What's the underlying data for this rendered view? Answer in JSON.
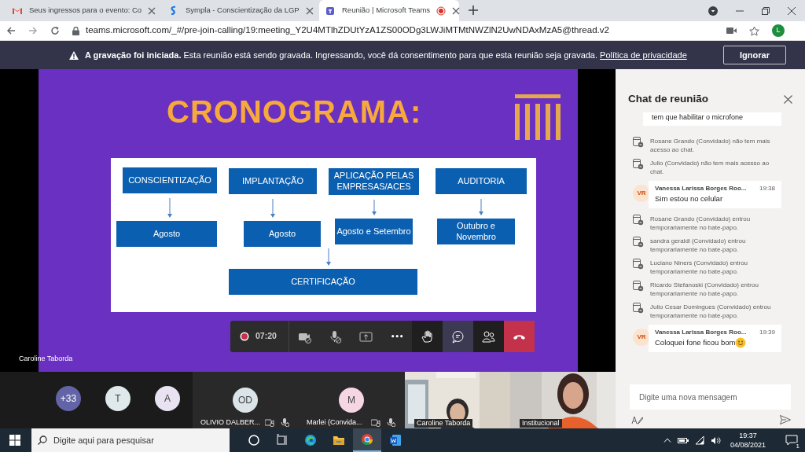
{
  "browser": {
    "tabs": [
      {
        "kind": "gmail",
        "title": "Seus ingressos para o evento: Co",
        "selected": false,
        "recording": false
      },
      {
        "kind": "sympla",
        "title": "Sympla - Conscientização da LGP",
        "selected": false,
        "recording": false
      },
      {
        "kind": "teams",
        "title": "Reunião | Microsoft Teams",
        "selected": true,
        "recording": true
      }
    ],
    "url": "teams.microsoft.com/_#/pre-join-calling/19:meeting_Y2U4MTlhZDUtYzA1ZS00ODg3LWJiMTMtNWZlN2UwNDAxMzA5@thread.v2",
    "profile": "L"
  },
  "banner": {
    "text": "**A gravação foi iniciada.** Esta reunião está sendo gravada. Ingressando, você dá consentimento para que esta reunião seja gravada.",
    "link": "Política de privacidade",
    "button": "Ignorar"
  },
  "slide": {
    "title": "CRONOGRAMA:",
    "phases": [
      {
        "label": "CONSCIENTIZAÇÃO",
        "period": "Agosto"
      },
      {
        "label": "IMPLANTAÇÃO",
        "period": "Agosto"
      },
      {
        "label": "APLICAÇÃO PELAS EMPRESAS/ACES",
        "period": "Agosto e Setembro"
      },
      {
        "label": "AUDITORIA",
        "period": "Outubro e Novembro"
      }
    ],
    "final": "CERTIFICAÇÃO"
  },
  "presenter": "Caroline Taborda",
  "call_controls": {
    "recording": true,
    "timer": "07:20",
    "buttons": [
      {
        "kind": "camera-off",
        "selected": false
      },
      {
        "kind": "mic-off",
        "selected": false
      },
      {
        "kind": "share",
        "selected": false
      },
      {
        "kind": "more",
        "selected": false
      },
      {
        "kind": "hand",
        "selected": false
      },
      {
        "kind": "chat",
        "selected": true
      },
      {
        "kind": "people",
        "selected": false
      },
      {
        "kind": "hangup"
      }
    ]
  },
  "participants": [
    {
      "kind": "group",
      "avatars": [
        {
          "initials": "+33",
          "color": "#6264a7"
        },
        {
          "initials": "T",
          "color": "#dfe8ea"
        },
        {
          "initials": "A",
          "color": "#e8e2f2"
        }
      ]
    },
    {
      "kind": "avatar",
      "initials": "OD",
      "color": "#dbe4e8",
      "name": "OLIVIO DALBER..."
    },
    {
      "kind": "avatar",
      "initials": "M",
      "color": "#f6d6e2",
      "name": "Marlei (Convida..."
    },
    {
      "kind": "video",
      "name": "Caroline Taborda"
    },
    {
      "kind": "video",
      "name": "Institucional"
    }
  ],
  "chat": {
    "title": "Chat de reunião",
    "items": [
      {
        "kind": "fragment",
        "text": "tem que habilitar o microfone"
      },
      {
        "kind": "system",
        "text": "Rosane Grando (Convidado) não tem mais acesso ao chat."
      },
      {
        "kind": "system",
        "text": "Julio (Convidado) não tem mais acesso ao chat."
      },
      {
        "kind": "message",
        "initials": "VR",
        "author": "Vanessa Larissa Borges Roo...",
        "time": "19:38",
        "text": "Sim estou no celular"
      },
      {
        "kind": "system",
        "text": "Rosane Grando (Convidado) entrou temporariamente no bate-papo."
      },
      {
        "kind": "system",
        "text": "sandra geraldi (Convidado) entrou temporariamente no bate-papo."
      },
      {
        "kind": "system",
        "text": "Luciano Niners (Convidado) entrou temporariamente no bate-papo."
      },
      {
        "kind": "system",
        "text": "Ricardo Stefanoski (Convidado) entrou temporariamente no bate-papo."
      },
      {
        "kind": "system",
        "text": "Julio Cesar Domingues (Convidado) entrou temporariamente no bate-papo."
      },
      {
        "kind": "message",
        "initials": "VR",
        "author": "Vanessa Larissa Borges Roo...",
        "time": "19:39",
        "text": "Coloquei fone ficou bom",
        "emoji": true
      }
    ],
    "placeholder": "Digite uma nova mensagem"
  },
  "taskbar": {
    "search_placeholder": "Digite aqui para pesquisar",
    "apps": [
      {
        "kind": "cortana",
        "selected": false
      },
      {
        "kind": "taskview",
        "selected": false
      },
      {
        "kind": "edge",
        "selected": false
      },
      {
        "kind": "folder",
        "selected": false
      },
      {
        "kind": "chrome",
        "selected": true
      },
      {
        "kind": "word",
        "selected": false
      }
    ],
    "time": "19:37",
    "date": "04/08/2021",
    "notifications": "1"
  }
}
